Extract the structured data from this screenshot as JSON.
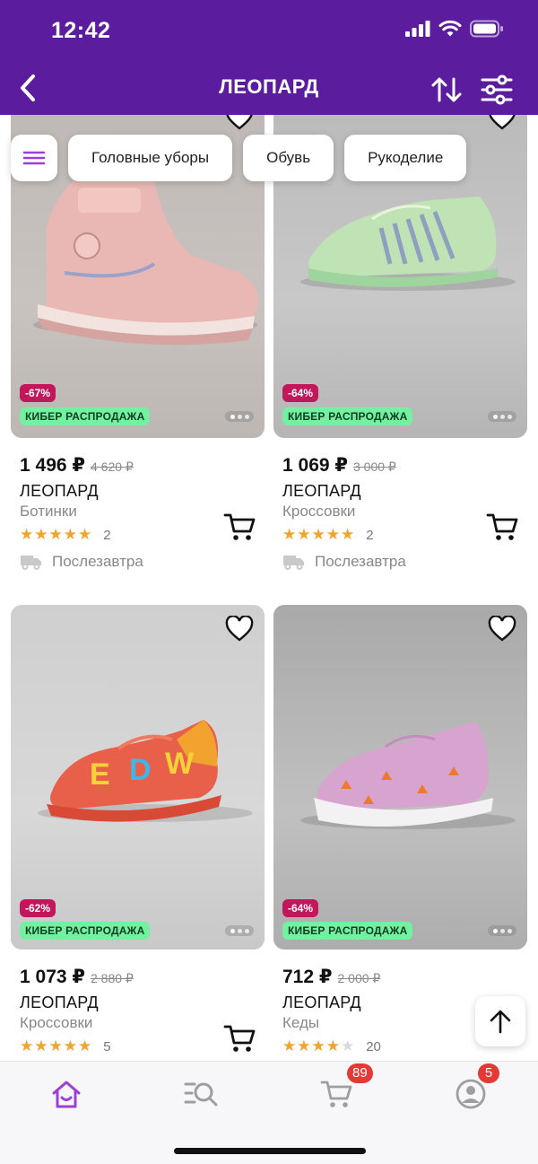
{
  "status_bar": {
    "time": "12:42"
  },
  "header": {
    "title": "ЛЕОПАРД",
    "back_icon": "chevron-left-icon",
    "sort_icon": "sort-arrows-icon",
    "filter_icon": "sliders-icon"
  },
  "chips": [
    "Головные уборы",
    "Обувь",
    "Рукоделие"
  ],
  "colors": {
    "brand": "#5b1d9e",
    "discount": "#c2185b",
    "promo": "#74f0a1",
    "star": "#f2a52c",
    "badge": "#e53935"
  },
  "products": [
    {
      "discount": "-67%",
      "promo": "КИБЕР РАСПРОДАЖА",
      "price": "1 496 ₽",
      "old_price": "4 620 ₽",
      "brand": "ЛЕОПАРД",
      "kind": "Ботинки",
      "rating": 5,
      "reviews": "2",
      "delivery": "Послезавтра"
    },
    {
      "discount": "-64%",
      "promo": "КИБЕР РАСПРОДАЖА",
      "price": "1 069 ₽",
      "old_price": "3 000 ₽",
      "brand": "ЛЕОПАРД",
      "kind": "Кроссовки",
      "rating": 5,
      "reviews": "2",
      "delivery": "Послезавтра"
    },
    {
      "discount": "-62%",
      "promo": "КИБЕР РАСПРОДАЖА",
      "price": "1 073 ₽",
      "old_price": "2 880 ₽",
      "brand": "ЛЕОПАРД",
      "kind": "Кроссовки",
      "rating": 5,
      "reviews": "5"
    },
    {
      "discount": "-64%",
      "promo": "КИБЕР РАСПРОДАЖА",
      "price": "712 ₽",
      "old_price": "2 000 ₽",
      "brand": "ЛЕОПАРД",
      "kind": "Кеды",
      "rating": 4,
      "reviews": "20"
    }
  ],
  "tabbar": {
    "cart_badge": "89",
    "profile_badge": "5"
  }
}
